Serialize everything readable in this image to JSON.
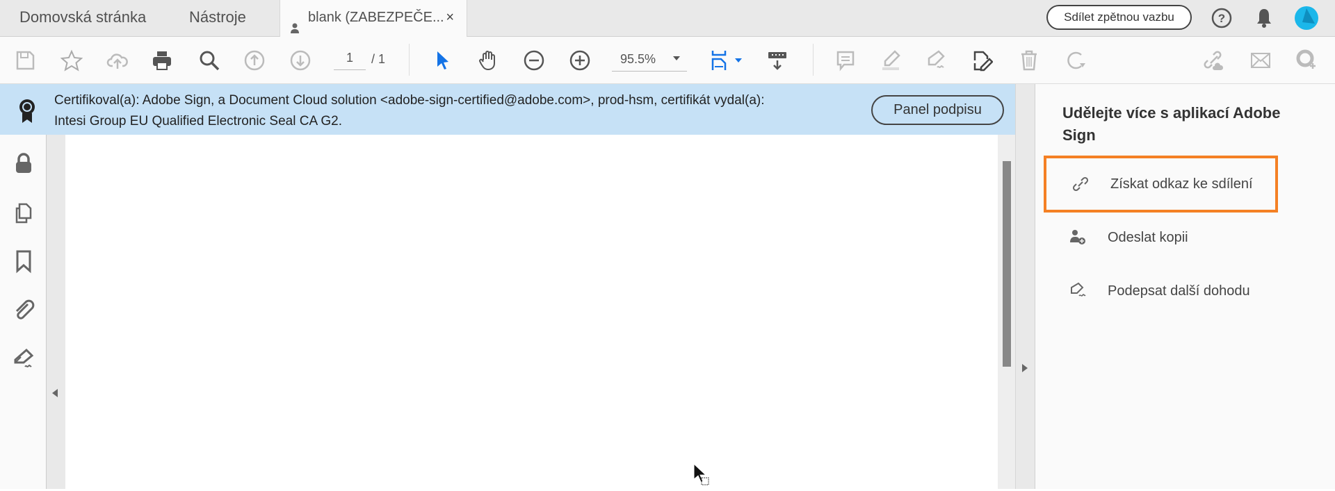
{
  "tabs": {
    "home": "Domovská stránka",
    "tools": "Nástroje",
    "document": "blank (ZABEZPEČE...",
    "close": "×"
  },
  "header": {
    "feedback": "Sdílet zpětnou vazbu"
  },
  "toolbar": {
    "page_current": "1",
    "page_total": "/ 1",
    "zoom": "95.5%"
  },
  "banner": {
    "line1": "Certifikoval(a): Adobe Sign, a Document Cloud solution <adobe-sign-certified@adobe.com>, prod-hsm, certifikát vydal(a):",
    "line2": "Intesi Group EU Qualified Electronic Seal CA G2.",
    "button": "Panel podpisu"
  },
  "right_panel": {
    "title": "Udělejte více s aplikací Adobe Sign",
    "items": [
      {
        "label": "Získat odkaz ke sdílení",
        "icon": "link-icon"
      },
      {
        "label": "Odeslat kopii",
        "icon": "user-add-icon"
      },
      {
        "label": "Podepsat další dohodu",
        "icon": "pen-sign-icon"
      }
    ]
  },
  "colors": {
    "highlight": "#f48024",
    "banner": "#c6e1f6",
    "accent": "#1473e6"
  }
}
